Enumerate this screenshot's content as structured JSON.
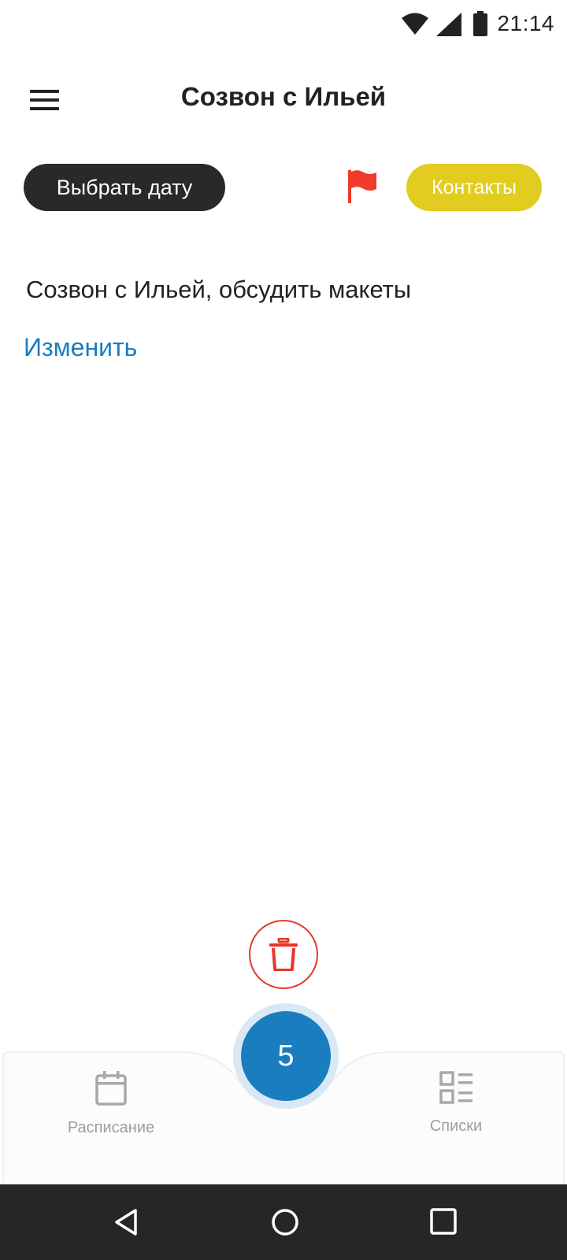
{
  "status_bar": {
    "time": "21:14"
  },
  "header": {
    "title": "Созвон с Ильей"
  },
  "controls": {
    "date_button_label": "Выбрать дату",
    "contacts_button_label": "Контакты"
  },
  "task": {
    "text": "Созвон с Ильей, обсудить макеты",
    "edit_label": "Изменить"
  },
  "bottom_nav": {
    "schedule_label": "Расписание",
    "lists_label": "Списки",
    "fab_value": "5"
  },
  "colors": {
    "accent_blue": "#1a7dc0",
    "accent_yellow": "#e2cc1f",
    "danger_red": "#e8352b",
    "dark_button": "#28292b"
  },
  "icons": [
    "wifi-icon",
    "cell-signal-icon",
    "battery-icon",
    "menu-icon",
    "flag-icon",
    "trash-icon",
    "calendar-icon",
    "list-icon",
    "back-icon",
    "home-icon",
    "recents-icon"
  ]
}
